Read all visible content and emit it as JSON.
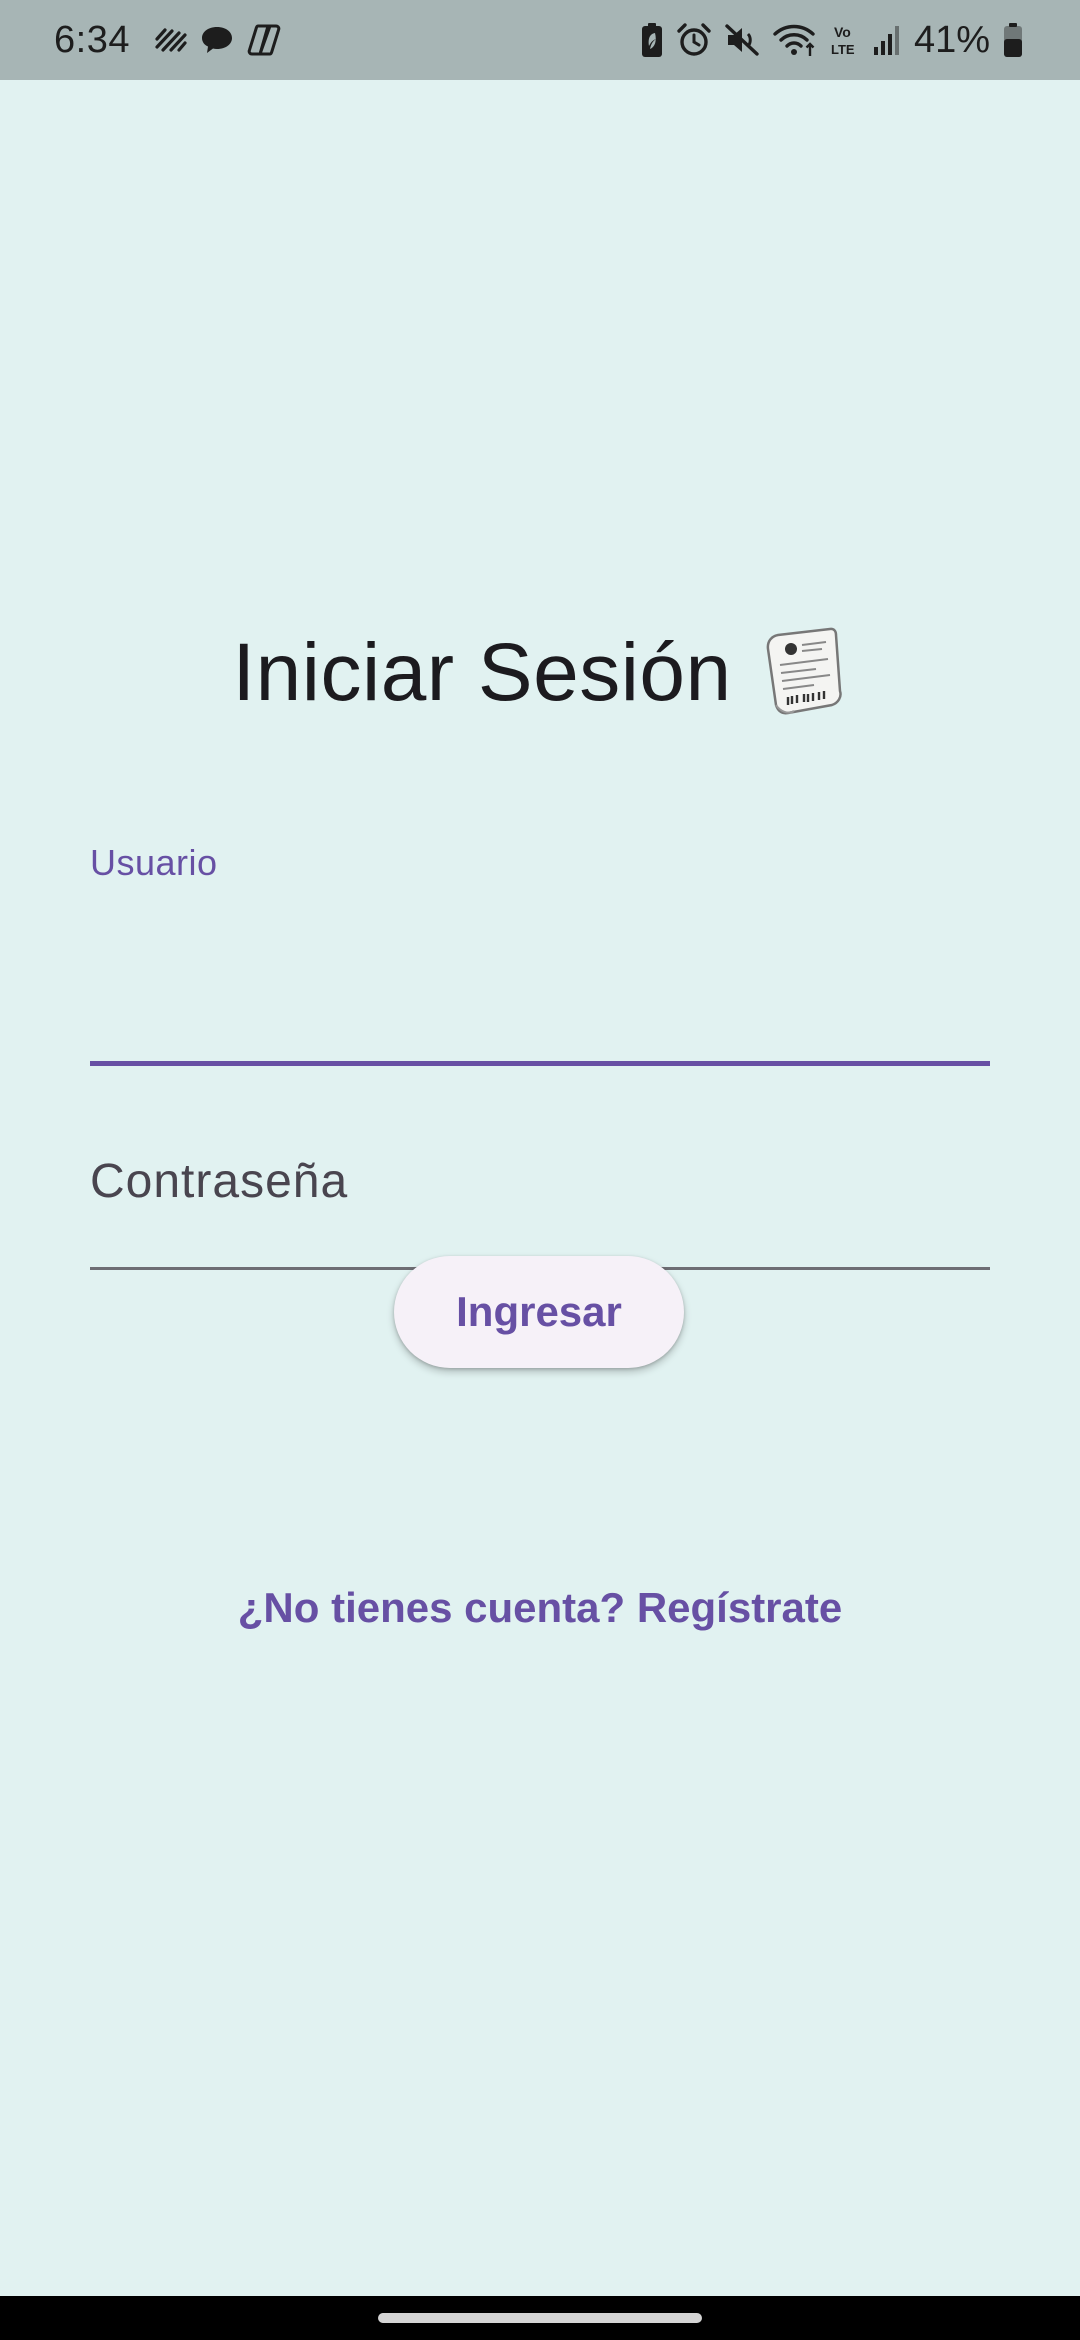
{
  "status_bar": {
    "time": "6:34",
    "battery_percent": "41%",
    "notification_icons": [
      "stripes-icon",
      "chat-bubble-icon",
      "copilot-icon"
    ],
    "system_icons": [
      "battery-saver-icon",
      "alarm-icon",
      "mute-icon",
      "wifi-icon",
      "volte-icon",
      "signal-icon",
      "battery-icon"
    ],
    "volte_label_top": "Vo",
    "volte_label_bottom": "LTE"
  },
  "login": {
    "title": "Iniciar Sesión",
    "title_icon": "receipt-icon",
    "username": {
      "label": "Usuario",
      "value": ""
    },
    "password": {
      "label": "Contraseña",
      "value": ""
    },
    "submit_label": "Ingresar",
    "register_link": "¿No tienes cuenta? Regístrate"
  },
  "colors": {
    "background": "#e1f2f1",
    "status_bar": "#a7b5b5",
    "accent": "#6750a4",
    "button_bg": "#f6f1f8",
    "text": "#1c1b1f"
  }
}
